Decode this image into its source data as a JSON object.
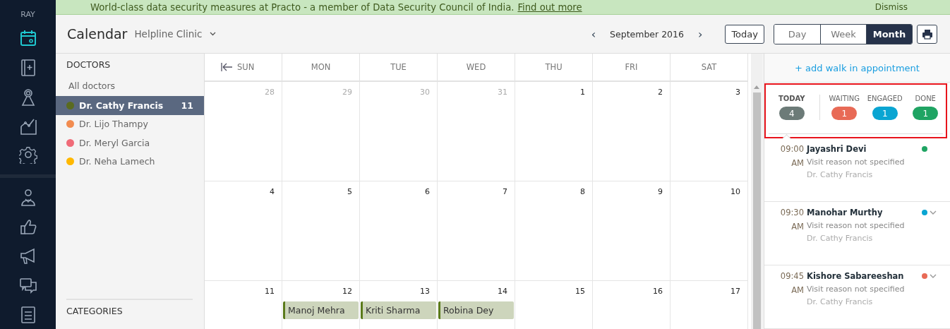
{
  "sidebar": {
    "user": "RAY",
    "items": [
      {
        "kind": "calendar",
        "selected": true
      },
      {
        "kind": "book",
        "selected": false
      },
      {
        "kind": "award",
        "selected": false
      },
      {
        "kind": "chart",
        "selected": false
      },
      {
        "kind": "gear",
        "selected": false
      },
      {
        "kind": "person",
        "selected": false,
        "group_start": true
      },
      {
        "kind": "thumb",
        "selected": false
      },
      {
        "kind": "megaphone",
        "selected": false
      },
      {
        "kind": "chat",
        "selected": false
      },
      {
        "kind": "list",
        "selected": false
      }
    ]
  },
  "banner": {
    "text": "World-class data security measures at Practo - a member of Data Security Council of India.",
    "link": "Find out more",
    "dismiss": "Dismiss"
  },
  "header": {
    "title": "Calendar",
    "clinic": "Helpline Clinic",
    "prev": "‹",
    "month": "September 2016",
    "next": "›",
    "today_button": "Today",
    "views": [
      {
        "label": "Day",
        "selected": false
      },
      {
        "label": "Week",
        "selected": false
      },
      {
        "label": "Month",
        "selected": true
      }
    ]
  },
  "doctors": {
    "heading": "DOCTORS",
    "all": "All doctors",
    "items": [
      {
        "name": "Dr. Cathy Francis",
        "color": "#5a6b1f",
        "selected": true,
        "count": "11"
      },
      {
        "name": "Dr. Lijo Thampy",
        "color": "#f28c50",
        "selected": false
      },
      {
        "name": "Dr. Meryl Garcia",
        "color": "#f06b78",
        "selected": false
      },
      {
        "name": "Dr. Neha Lamech",
        "color": "#ffb800",
        "selected": false
      }
    ],
    "categories_heading": "CATEGORIES"
  },
  "calendar": {
    "columns": [
      "SUN",
      "MON",
      "TUE",
      "WED",
      "THU",
      "FRI",
      "SAT"
    ],
    "weeks": [
      [
        {
          "day": "28",
          "muted": true
        },
        {
          "day": "29",
          "muted": true
        },
        {
          "day": "30",
          "muted": true
        },
        {
          "day": "31",
          "muted": true
        },
        {
          "day": "1",
          "muted": false
        },
        {
          "day": "2",
          "muted": false
        },
        {
          "day": "3",
          "muted": false
        }
      ],
      [
        {
          "day": "4",
          "muted": false
        },
        {
          "day": "5",
          "muted": false
        },
        {
          "day": "6",
          "muted": false
        },
        {
          "day": "7",
          "muted": false
        },
        {
          "day": "8",
          "muted": false
        },
        {
          "day": "9",
          "muted": false
        },
        {
          "day": "10",
          "muted": false
        }
      ],
      [
        {
          "day": "11",
          "muted": false
        },
        {
          "day": "12",
          "muted": false,
          "events": [
            "Manoj Mehra"
          ]
        },
        {
          "day": "13",
          "muted": false,
          "events": [
            "Kriti Sharma"
          ]
        },
        {
          "day": "14",
          "muted": false,
          "events": [
            "Robina Dey"
          ]
        },
        {
          "day": "15",
          "muted": false
        },
        {
          "day": "16",
          "muted": false
        },
        {
          "day": "17",
          "muted": false
        }
      ]
    ]
  },
  "queue": {
    "add_link": "+ add walk in appointment",
    "stats": [
      {
        "label": "TODAY",
        "count": "4",
        "color": "#6c7b78",
        "selected": true
      },
      {
        "label": "WAITING",
        "count": "1",
        "color": "#e86a56",
        "selected": false
      },
      {
        "label": "ENGAGED",
        "count": "1",
        "color": "#0aa5d2",
        "selected": false
      },
      {
        "label": "DONE",
        "count": "1",
        "color": "#1fa463",
        "selected": false
      }
    ],
    "appointments": [
      {
        "time": "09:00",
        "ampm": "AM",
        "patient": "Jayashri Devi",
        "reason": "Visit reason not specified",
        "doctor": "Dr. Cathy Francis",
        "color": "#1fa463",
        "expandable": false
      },
      {
        "time": "09:30",
        "ampm": "AM",
        "patient": "Manohar Murthy",
        "reason": "Visit reason not specified",
        "doctor": "Dr. Cathy Francis",
        "color": "#0aa5d2",
        "expandable": true
      },
      {
        "time": "09:45",
        "ampm": "AM",
        "patient": "Kishore Sabareeshan",
        "reason": "Visit reason not specified",
        "doctor": "Dr. Cathy Francis",
        "color": "#e86a56",
        "expandable": true
      }
    ]
  }
}
